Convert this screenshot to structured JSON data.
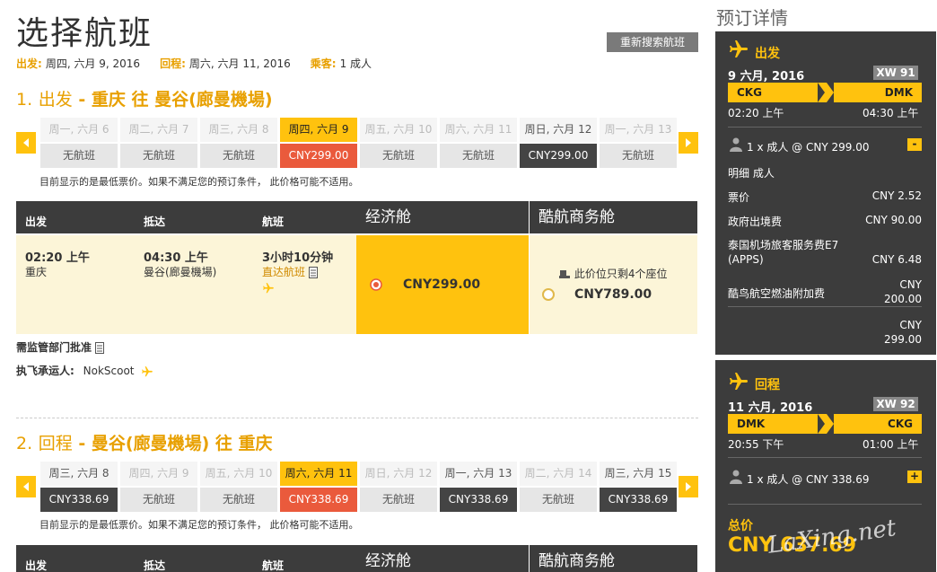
{
  "header": {
    "title": "选择航班",
    "research_button": "重新搜索航班",
    "summary": [
      {
        "key": "出发:",
        "value": "周四, 六月 9, 2016"
      },
      {
        "key": "回程:",
        "value": "周六, 六月 11, 2016"
      },
      {
        "key": "乘客:",
        "value": "1 成人"
      }
    ]
  },
  "outbound": {
    "title_prefix": "1.",
    "direction": "出发",
    "route": "- 重庆 往 曼谷(廊曼機場)",
    "days": [
      {
        "date": "周一, 六月 6",
        "price": "无航班"
      },
      {
        "date": "周二, 六月 7",
        "price": "无航班"
      },
      {
        "date": "周三, 六月 8",
        "price": "无航班"
      },
      {
        "date": "周四, 六月 9",
        "price": "CNY299.00"
      },
      {
        "date": "周五, 六月 10",
        "price": "无航班"
      },
      {
        "date": "周六, 六月 11",
        "price": "无航班"
      },
      {
        "date": "周日, 六月 12",
        "price": "CNY299.00"
      },
      {
        "date": "周一, 六月 13",
        "price": "无航班"
      }
    ],
    "note": "目前显示的是最低票价。如果不满足您的预订条件， 此价格可能不适用。",
    "table_headers": {
      "depart": "出发",
      "arrive": "抵达",
      "flight": "航班",
      "economy": "经济舱",
      "business": "酷航商务舱"
    },
    "flight": {
      "dep_time": "02:20 上午",
      "dep_city": "重庆",
      "arr_time": "04:30 上午",
      "arr_city": "曼谷(廊曼機場)",
      "duration": "3小时10分钟",
      "type": "直达航班",
      "economy_price": "CNY299.00",
      "business_seats": "此价位只剩4个座位",
      "business_price": "CNY789.00"
    },
    "approval": "需监管部门批准",
    "carrier_label": "执飞承运人:",
    "carrier": "NokScoot"
  },
  "inbound": {
    "title_prefix": "2.",
    "direction": "回程",
    "route": "- 曼谷(廊曼機場) 往 重庆",
    "days": [
      {
        "date": "周三, 六月 8",
        "price": "CNY338.69"
      },
      {
        "date": "周四, 六月 9",
        "price": "无航班"
      },
      {
        "date": "周五, 六月 10",
        "price": "无航班"
      },
      {
        "date": "周六, 六月 11",
        "price": "CNY338.69"
      },
      {
        "date": "周日, 六月 12",
        "price": "无航班"
      },
      {
        "date": "周一, 六月 13",
        "price": "CNY338.69"
      },
      {
        "date": "周二, 六月 14",
        "price": "无航班"
      },
      {
        "date": "周三, 六月 15",
        "price": "CNY338.69"
      }
    ],
    "note": "目前显示的是最低票价。如果不满足您的预订条件， 此价格可能不适用。",
    "table_headers": {
      "depart": "出发",
      "arrive": "抵达",
      "flight": "航班",
      "economy": "经济舱",
      "business": "酷航商务舱"
    }
  },
  "sidebar": {
    "title": "预订详情",
    "outbound": {
      "label": "出发",
      "date": "9 六月, 2016",
      "flight_no": "XW 91",
      "from": "CKG",
      "to": "DMK",
      "dep": "02:20 上午",
      "arr": "04:30 上午",
      "pax": "1 x 成人 @ CNY 299.00",
      "toggle": "-",
      "breakdown_title": "明细 成人",
      "fees": [
        {
          "name": "票价",
          "amount": "CNY 2.52"
        },
        {
          "name": "政府出境费",
          "amount": "CNY 90.00"
        },
        {
          "name": "泰国机场旅客服务费E7 (APPS)",
          "amount": "CNY 6.48"
        },
        {
          "name": "酷鸟航空燃油附加费",
          "amount": "CNY 200.00"
        }
      ],
      "subtotal": "CNY 299.00"
    },
    "inbound": {
      "label": "回程",
      "date": "11 六月, 2016",
      "flight_no": "XW 92",
      "from": "DMK",
      "to": "CKG",
      "dep": "20:55 下午",
      "arr": "01:00 上午",
      "pax": "1 x 成人 @ CNY 338.69",
      "toggle": "+"
    },
    "total_label": "总价",
    "total": "CNY 637.69",
    "watermark": "LaXing.net"
  },
  "colors": {
    "accent": "#ffc20e",
    "dark": "#3c3c3c",
    "red": "#ea5a3c",
    "orange_text": "#e8a000"
  }
}
